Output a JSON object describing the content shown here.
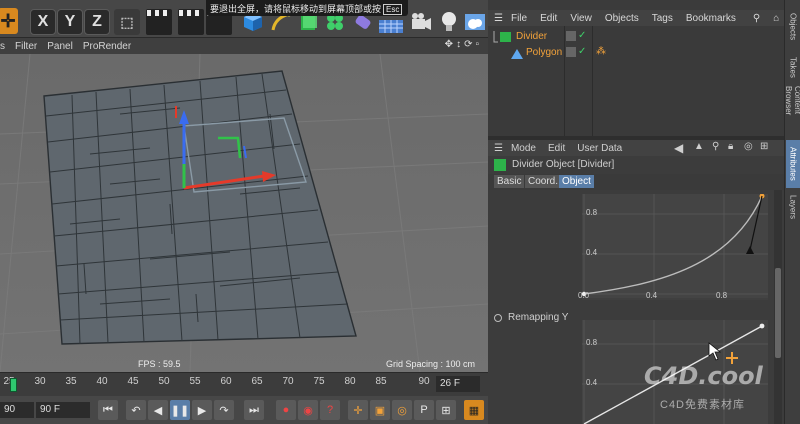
{
  "toolbar": {
    "axis_buttons": [
      "X",
      "Y",
      "Z"
    ],
    "icons": [
      "move-icon",
      "undo-icon",
      "x-axis-lock-icon",
      "y-axis-lock-icon",
      "z-axis-lock-icon",
      "world-coords-icon",
      "render-view-icon",
      "render-picture-queue-icon",
      "edit-render-settings-icon",
      "cube-icon",
      "bend-pen-icon",
      "subdivision-icon",
      "array-icon",
      "deformer-icon",
      "scene-floor-icon",
      "camera-icon",
      "light-icon",
      "sky-icon"
    ],
    "notice": "要退出全屏，请将鼠标移动到屏幕顶部或按",
    "notice_key": "Esc"
  },
  "viewport": {
    "menu": [
      "s",
      "Filter",
      "Panel",
      "ProRender"
    ],
    "menu_icons": [
      "move-view-icon",
      "zoom-view-icon",
      "rotate-view-icon",
      "maximize-view-icon"
    ],
    "fps": "FPS : 59.5",
    "grid_spacing": "Grid Spacing : 100 cm"
  },
  "timeline": {
    "ticks": [
      "25",
      "30",
      "35",
      "40",
      "45",
      "50",
      "55",
      "60",
      "65",
      "70",
      "75",
      "80",
      "85",
      "90"
    ],
    "current_frame": "26 F",
    "start_field": "90",
    "end_field": "90 F"
  },
  "transport": {
    "buttons": [
      "go-to-start-icon",
      "prev-key-icon",
      "prev-frame-icon",
      "play-icon",
      "next-frame-icon",
      "next-key-icon",
      "go-to-end-icon",
      "record-icon",
      "autokey-icon",
      "keyframe-selection-icon",
      "move-key-icon",
      "scale-key-icon",
      "rotate-key-icon",
      "param-key-icon",
      "pla-icon",
      "film-icon"
    ]
  },
  "object_manager": {
    "menu": [
      "File",
      "Edit",
      "View",
      "Objects",
      "Tags",
      "Bookmarks"
    ],
    "objects": [
      {
        "name": "Divider"
      },
      {
        "name": "Polygon"
      }
    ]
  },
  "attributes": {
    "menu": [
      "Mode",
      "Edit",
      "User Data"
    ],
    "title": "Divider Object [Divider]",
    "tabs": [
      "Basic",
      "Coord.",
      "Object"
    ],
    "active_tab": "Object",
    "remapping_label": "Remapping Y",
    "graph1": {
      "y_ticks": [
        "0.8",
        "0.4"
      ],
      "x_ticks": [
        "0.0",
        "0.4",
        "0.8"
      ]
    },
    "graph2": {
      "y_ticks": [
        "0.8",
        "0.4"
      ]
    }
  },
  "dock": {
    "tabs": [
      "Objects",
      "Takes",
      "Content Browser",
      "Attributes",
      "Layers"
    ],
    "active": "Attributes"
  },
  "watermark": {
    "main": "C4D.cool",
    "sub": "C4D免费素材库"
  },
  "colors": {
    "accent": "#5a7ea8",
    "object_name": "#f2a23a",
    "playhead": "#2fc76f",
    "axis_x": "#e53a2a",
    "axis_y": "#31c24a",
    "axis_z": "#2f62e6"
  }
}
